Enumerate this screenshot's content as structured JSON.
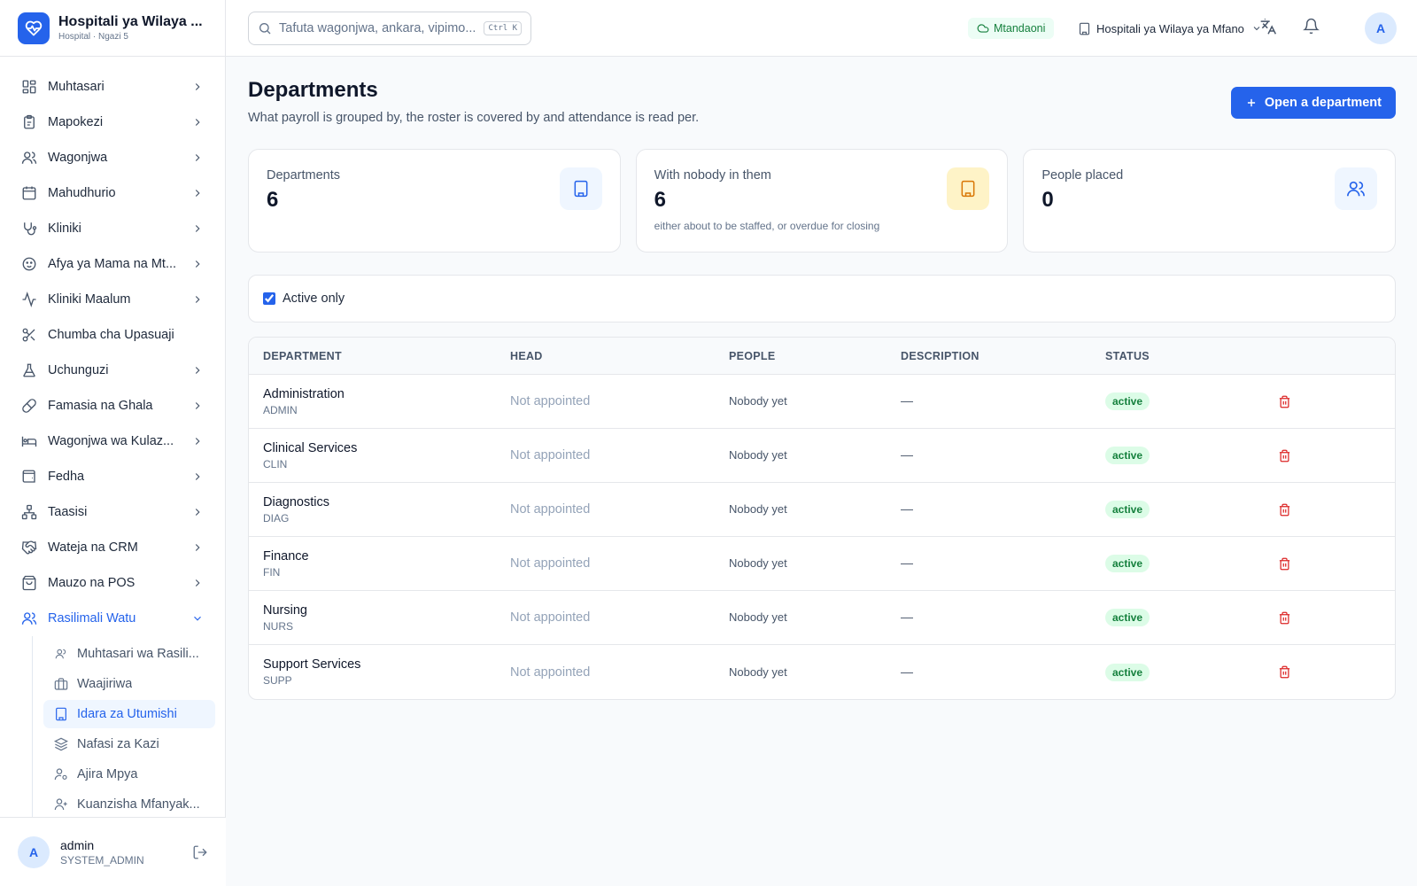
{
  "brand": {
    "name": "Hospitali ya Wilaya ...",
    "sub": "Hospital · Ngazi 5"
  },
  "sidebar": {
    "items": [
      {
        "label": "Muhtasari",
        "icon": "grid-icon"
      },
      {
        "label": "Mapokezi",
        "icon": "clipboard-icon"
      },
      {
        "label": "Wagonjwa",
        "icon": "users-icon"
      },
      {
        "label": "Mahudhurio",
        "icon": "calendar-icon"
      },
      {
        "label": "Kliniki",
        "icon": "stethoscope-icon"
      },
      {
        "label": "Afya ya Mama na Mt...",
        "icon": "baby-icon"
      },
      {
        "label": "Kliniki Maalum",
        "icon": "activity-icon"
      },
      {
        "label": "Chumba cha Upasuaji",
        "icon": "scissors-icon"
      },
      {
        "label": "Uchunguzi",
        "icon": "flask-icon"
      },
      {
        "label": "Famasia na Ghala",
        "icon": "pill-icon"
      },
      {
        "label": "Wagonjwa wa Kulaz...",
        "icon": "bed-icon"
      },
      {
        "label": "Fedha",
        "icon": "wallet-icon"
      },
      {
        "label": "Taasisi",
        "icon": "network-icon"
      },
      {
        "label": "Wateja na CRM",
        "icon": "handshake-icon"
      },
      {
        "label": "Mauzo na POS",
        "icon": "shopping-bag-icon"
      },
      {
        "label": "Rasilimali Watu",
        "icon": "users-icon"
      }
    ],
    "subitems": [
      {
        "label": "Muhtasari wa Rasili...",
        "icon": "users-icon"
      },
      {
        "label": "Waajiriwa",
        "icon": "briefcase-icon"
      },
      {
        "label": "Idara za Utumishi",
        "icon": "building-icon"
      },
      {
        "label": "Nafasi za Kazi",
        "icon": "layers-icon"
      },
      {
        "label": "Ajira Mpya",
        "icon": "user-cog-icon"
      },
      {
        "label": "Kuanzisha Mfanyak...",
        "icon": "user-plus-icon"
      }
    ]
  },
  "user": {
    "initial": "A",
    "name": "admin",
    "role": "SYSTEM_ADMIN"
  },
  "header": {
    "search_placeholder": "Tafuta wagonjwa, ankara, vipimo...",
    "search_shortcut": "Ctrl K",
    "status": "Mtandaoni",
    "facility": "Hospitali ya Wilaya ya Mfano",
    "avatar": "A"
  },
  "page": {
    "title": "Departments",
    "subtitle": "What payroll is grouped by, the roster is covered by and attendance is read per.",
    "primary_action": "Open a department"
  },
  "stats": [
    {
      "label": "Departments",
      "value": "6",
      "note": ""
    },
    {
      "label": "With nobody in them",
      "value": "6",
      "note": "either about to be staffed, or overdue for closing"
    },
    {
      "label": "People placed",
      "value": "0",
      "note": ""
    }
  ],
  "filter": {
    "label": "Active only",
    "checked": true
  },
  "table": {
    "columns": [
      "DEPARTMENT",
      "HEAD",
      "PEOPLE",
      "DESCRIPTION",
      "STATUS",
      ""
    ],
    "rows": [
      {
        "name": "Administration",
        "code": "ADMIN",
        "head": "Not appointed",
        "people": "Nobody yet",
        "description": "—",
        "status": "active"
      },
      {
        "name": "Clinical Services",
        "code": "CLIN",
        "head": "Not appointed",
        "people": "Nobody yet",
        "description": "—",
        "status": "active"
      },
      {
        "name": "Diagnostics",
        "code": "DIAG",
        "head": "Not appointed",
        "people": "Nobody yet",
        "description": "—",
        "status": "active"
      },
      {
        "name": "Finance",
        "code": "FIN",
        "head": "Not appointed",
        "people": "Nobody yet",
        "description": "—",
        "status": "active"
      },
      {
        "name": "Nursing",
        "code": "NURS",
        "head": "Not appointed",
        "people": "Nobody yet",
        "description": "—",
        "status": "active"
      },
      {
        "name": "Support Services",
        "code": "SUPP",
        "head": "Not appointed",
        "people": "Nobody yet",
        "description": "—",
        "status": "active"
      }
    ]
  },
  "colors": {
    "accent": "#2563eb",
    "success": "#15803d",
    "danger": "#dc2626",
    "warning": "#d97706"
  }
}
